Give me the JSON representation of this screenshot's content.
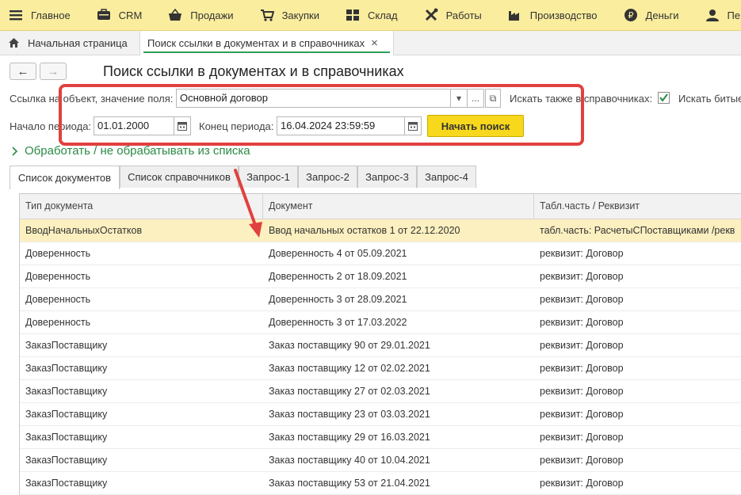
{
  "top_menu": [
    {
      "label": "Главное",
      "icon": "hamburger-icon"
    },
    {
      "label": "CRM",
      "icon": "crm-icon"
    },
    {
      "label": "Продажи",
      "icon": "sales-basket-icon"
    },
    {
      "label": "Закупки",
      "icon": "purchases-cart-icon"
    },
    {
      "label": "Склад",
      "icon": "warehouse-icon"
    },
    {
      "label": "Работы",
      "icon": "tools-icon"
    },
    {
      "label": "Производство",
      "icon": "factory-icon"
    },
    {
      "label": "Деньги",
      "icon": "money-ruble-icon"
    },
    {
      "label": "Пе",
      "icon": "person-icon"
    }
  ],
  "page_tabs": [
    {
      "label": "Начальная страница",
      "icon": "home-icon"
    },
    {
      "label": "Поиск ссылки в документах и в справочниках",
      "close": "×"
    }
  ],
  "nav": {
    "back": "←",
    "forward": "→"
  },
  "form": {
    "title": "Поиск ссылки в документах и в справочниках",
    "ref_label": "Ссылка на объект, значение поля:",
    "ref_value": "Основной договор",
    "dropdown_glyph": "▾",
    "select_glyph": "...",
    "open_glyph": "⧉",
    "search_catalogs_label": "Искать также в справочниках:",
    "search_catalogs_checked": true,
    "search_broken_label": "Искать битые",
    "start_label": "Начало периода:",
    "start_value": "01.01.2000",
    "end_label": "Конец периода:",
    "end_value": "16.04.2024 23:59:59",
    "search_button": "Начать поиск"
  },
  "process_link": "Обработать / не обрабатывать из списка",
  "form_tabs": [
    "Список документов",
    "Список справочников",
    "Запрос-1",
    "Запрос-2",
    "Запрос-3",
    "Запрос-4"
  ],
  "table": {
    "headers": [
      "Тип документа",
      "Документ",
      "Табл.часть / Реквизит"
    ],
    "rows": [
      [
        "ВводНачальныхОстатков",
        "Ввод начальных остатков 1 от 22.12.2020",
        "табл.часть: РасчетыСПоставщиками /рекв"
      ],
      [
        "Доверенность",
        "Доверенность 4 от 05.09.2021",
        "реквизит: Договор"
      ],
      [
        "Доверенность",
        "Доверенность 2 от 18.09.2021",
        "реквизит: Договор"
      ],
      [
        "Доверенность",
        "Доверенность 3 от 28.09.2021",
        "реквизит: Договор"
      ],
      [
        "Доверенность",
        "Доверенность 3 от 17.03.2022",
        "реквизит: Договор"
      ],
      [
        "ЗаказПоставщику",
        "Заказ поставщику 90 от 29.01.2021",
        "реквизит: Договор"
      ],
      [
        "ЗаказПоставщику",
        "Заказ поставщику 12 от 02.02.2021",
        "реквизит: Договор"
      ],
      [
        "ЗаказПоставщику",
        "Заказ поставщику 27 от 02.03.2021",
        "реквизит: Договор"
      ],
      [
        "ЗаказПоставщику",
        "Заказ поставщику 23 от 03.03.2021",
        "реквизит: Договор"
      ],
      [
        "ЗаказПоставщику",
        "Заказ поставщику 29 от 16.03.2021",
        "реквизит: Договор"
      ],
      [
        "ЗаказПоставщику",
        "Заказ поставщику 40 от 10.04.2021",
        "реквизит: Договор"
      ],
      [
        "ЗаказПоставщику",
        "Заказ поставщику 53 от 21.04.2021",
        "реквизит: Договор"
      ]
    ]
  },
  "colors": {
    "accent_yellow": "#f7d81c",
    "annotation_red": "#e0413f",
    "link_green": "#2a8a46",
    "selected_row": "#fcf0c0"
  }
}
